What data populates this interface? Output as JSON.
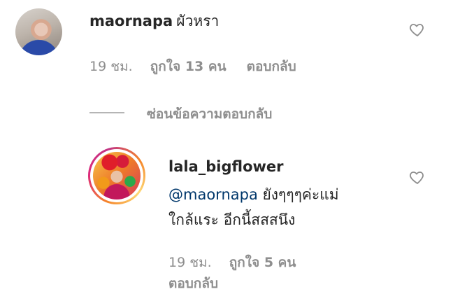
{
  "comments": [
    {
      "username": "maornapa",
      "text": "ผัวหรา",
      "time": "19 ชม.",
      "likes": "ถูกใจ 13 คน",
      "reply_label": "ตอบกลับ"
    },
    {
      "username": "lala_bigflower",
      "mention": "@maornapa",
      "text_line1": " ยังๆๆๆค่ะแม่",
      "text_line2": "ใกล้แระ อีกนี้สสสนึง",
      "time": "19 ชม.",
      "likes": "ถูกใจ 5 คน",
      "reply_label": "ตอบกลับ"
    }
  ],
  "hide_replies_label": "ซ่อนข้อความตอบกลับ",
  "icons": {
    "like": "heart-outline-icon"
  },
  "colors": {
    "text": "#262626",
    "secondary": "#8e8e8e",
    "mention": "#00376b"
  }
}
